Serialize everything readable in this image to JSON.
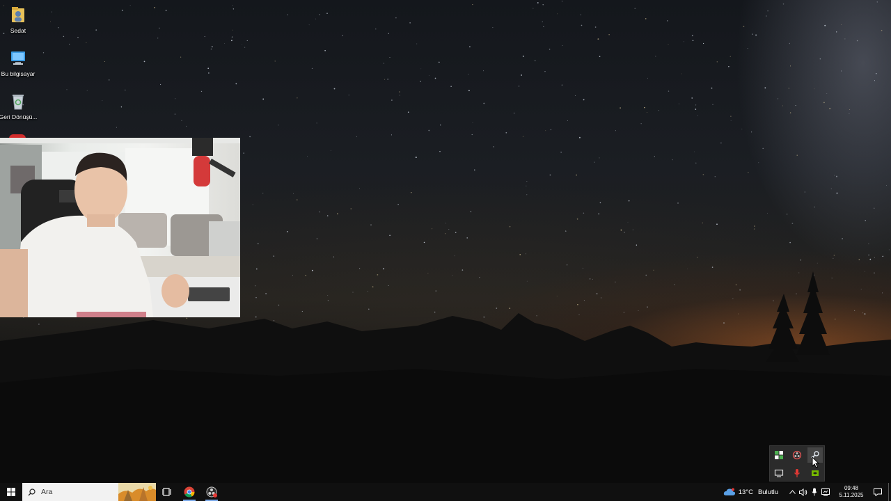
{
  "desktop": {
    "icons": [
      {
        "label": "Sedat",
        "icon": "user-folder-icon"
      },
      {
        "label": "Bu bilgisayar",
        "icon": "this-pc-icon"
      },
      {
        "label": "Geri Dönüşü...",
        "icon": "recycle-bin-icon"
      }
    ]
  },
  "webcam": {
    "icon": "webcam-overlay"
  },
  "tray_popup": {
    "items": [
      {
        "icon": "xbox-icon"
      },
      {
        "icon": "obs-icon"
      },
      {
        "icon": "steam-icon"
      },
      {
        "icon": "display-icon"
      },
      {
        "icon": "microphone-red-icon"
      },
      {
        "icon": "nvidia-icon"
      }
    ]
  },
  "taskbar": {
    "search_placeholder": "Ara",
    "weather_temp": "13°C",
    "weather_desc": "Bulutlu",
    "time": "09:48",
    "date": "5.11.2025",
    "colors": {
      "taskbar": "#101010",
      "accent": "#7aa8e8"
    }
  }
}
